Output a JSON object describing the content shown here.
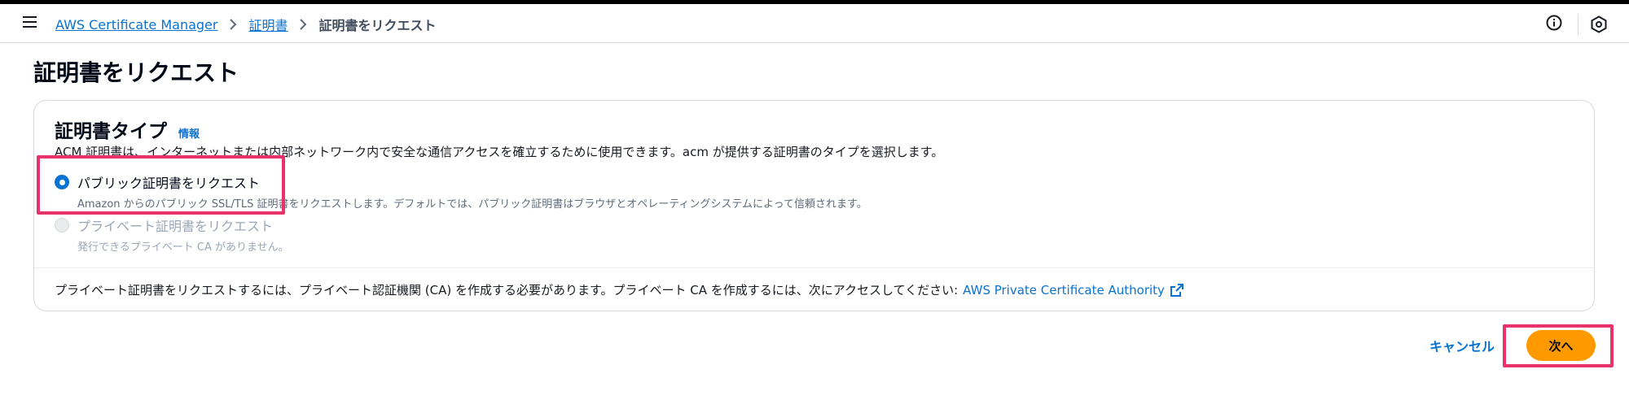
{
  "header": {
    "breadcrumb": {
      "service": "AWS Certificate Manager",
      "section": "証明書",
      "current": "証明書をリクエスト"
    },
    "icons": [
      "menu-icon",
      "info-circle-icon",
      "help-hexagon-icon"
    ]
  },
  "page": {
    "title": "証明書をリクエスト"
  },
  "panel": {
    "title": "証明書タイプ",
    "info_label": "情報",
    "description": "ACM 証明書は、インターネットまたは内部ネットワーク内で安全な通信アクセスを確立するために使用できます。acm が提供する証明書のタイプを選択します。",
    "options": [
      {
        "label": "パブリック証明書をリクエスト",
        "description": "Amazon からのパブリック SSL/TLS 証明書をリクエストします。デフォルトでは、パブリック証明書はブラウザとオペレーティングシステムによって信頼されます。",
        "selected": true,
        "disabled": false
      },
      {
        "label": "プライベート証明書をリクエスト",
        "description": "発行できるプライベート CA がありません。",
        "selected": false,
        "disabled": true
      }
    ],
    "footer_note": "プライベート証明書をリクエストするには、プライベート認証機関 (CA) を作成する必要があります。プライベート CA を作成するには、次にアクセスしてください:",
    "footer_link": "AWS Private Certificate Authority"
  },
  "actions": {
    "cancel_label": "キャンセル",
    "next_label": "次へ"
  },
  "colors": {
    "link": "#0972d3",
    "primary_button": "#ff9900",
    "highlight": "#e8336a",
    "disabled": "#9ba7b6"
  }
}
